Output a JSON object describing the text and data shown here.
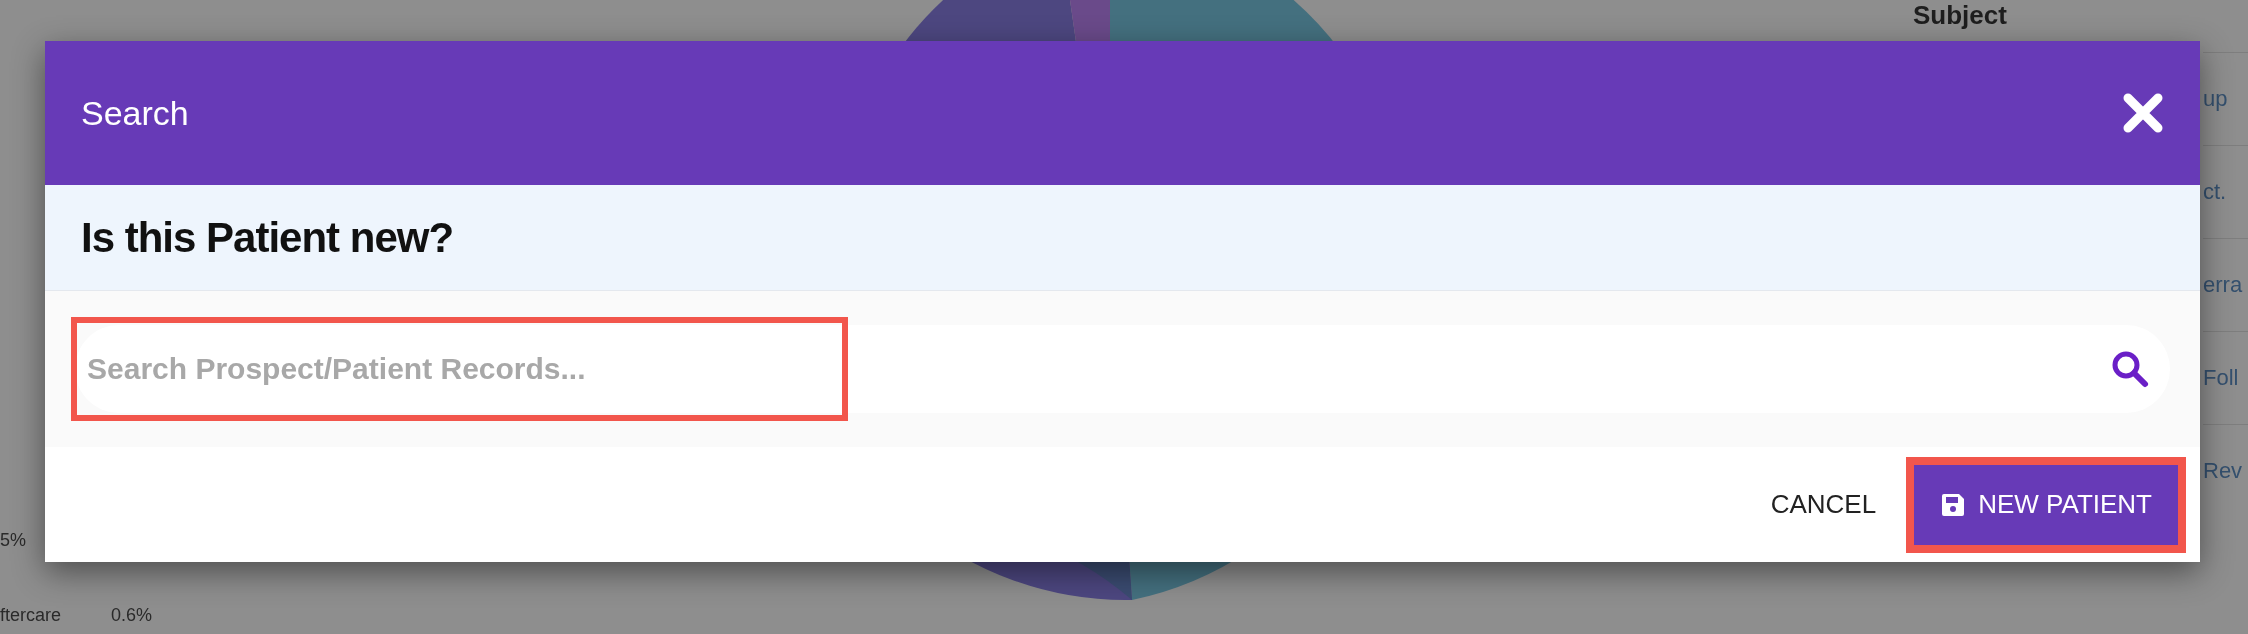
{
  "background": {
    "table_header": "Subject",
    "table_cells": [
      "up",
      "ct.",
      "erra",
      "Foll",
      "Rev"
    ],
    "left_texts": [
      "5%"
    ],
    "legend_row": {
      "label": "ftercare",
      "value": "0.6%"
    }
  },
  "dialog": {
    "title": "Search",
    "heading": "Is this Patient new?",
    "search": {
      "placeholder": "Search Prospect/Patient Records...",
      "highlighted": true
    },
    "buttons": [
      {
        "label": "CANCEL",
        "kind": "text",
        "highlighted": false
      },
      {
        "label": "NEW PATIENT",
        "kind": "primary",
        "highlighted": true
      }
    ]
  }
}
